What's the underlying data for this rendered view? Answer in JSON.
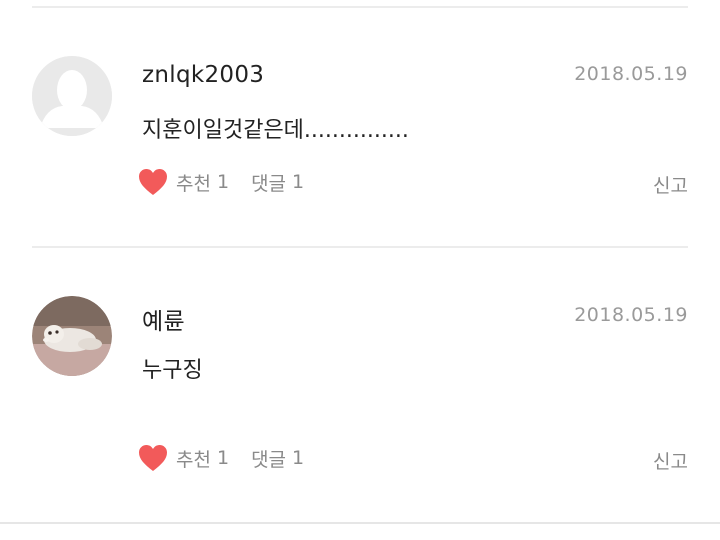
{
  "comments": [
    {
      "username": "znlqk2003",
      "date": "2018.05.19",
      "text": "지훈이일것같은데...............",
      "like_label": "추천",
      "like_count": "1",
      "reply_label": "댓글",
      "reply_count": "1",
      "report_label": "신고",
      "avatar": "default-profile-icon"
    },
    {
      "username": "예륜",
      "date": "2018.05.19",
      "text": "누구징",
      "like_label": "추천",
      "like_count": "1",
      "reply_label": "댓글",
      "reply_count": "1",
      "report_label": "신고",
      "avatar": "dog-photo"
    }
  ],
  "colors": {
    "heart": "#f25a5a",
    "date": "#9a9a9a",
    "action": "#8a8a8a",
    "divider": "#ececec"
  }
}
